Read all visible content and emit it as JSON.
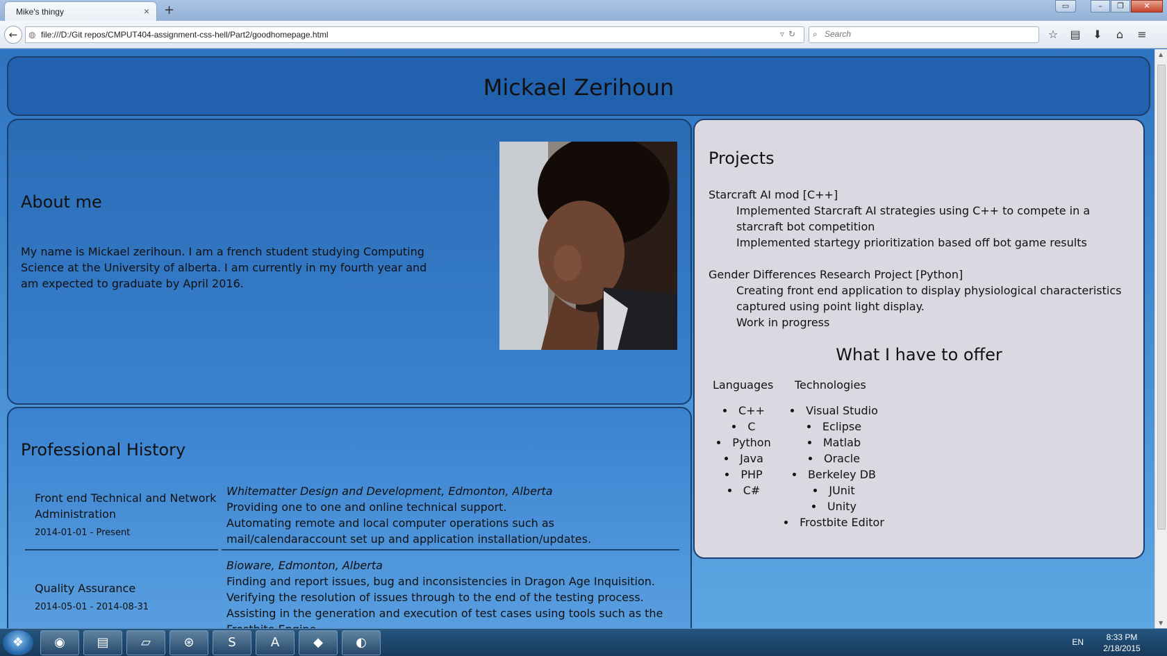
{
  "browser": {
    "tab_title": "Mike's thingy",
    "tab_close": "×",
    "new_tab": "+",
    "url": "file:///D:/Git repos/CMPUT404-assignment-css-hell/Part2/goodhomepage.html",
    "search_placeholder": "Search",
    "toolbar_icons": [
      "star-icon",
      "reading-list-icon",
      "download-icon",
      "home-icon",
      "menu-icon"
    ]
  },
  "page": {
    "name": "Mickael Zerihoun",
    "about": {
      "heading": "About me",
      "text": "My name is Mickael zerihoun. I am a french student studying Computing Science at the University of alberta. I am currently in my fourth year and am expected to graduate by April 2016."
    },
    "history": {
      "heading": "Professional History",
      "jobs": [
        {
          "role": "Front end Technical and Network Administration",
          "date": "2014-01-01 - Present",
          "company": "Whitematter Design and Development, Edmonton, Alberta",
          "lines": [
            "Providing one to one and online technical support.",
            "Automating remote and local computer operations such as mail/calendaraccount set up and application installation/updates."
          ]
        },
        {
          "role": "Quality Assurance",
          "date": "2014-05-01 - 2014-08-31",
          "company": "Bioware, Edmonton, Alberta",
          "lines": [
            "Finding and report issues, bug and inconsistencies in Dragon Age Inquisition.",
            "Verifying the resolution of issues through to the end of the testing process.",
            "Assisting in the generation and execution of test cases using tools such as the Frostbite Engine."
          ]
        }
      ]
    },
    "projects": {
      "heading": "Projects",
      "items": [
        {
          "title": "Starcraft AI mod [C++]",
          "points": [
            "Implemented Starcraft AI strategies using C++ to compete in a starcraft bot competition",
            "Implemented startegy prioritization based off bot game results"
          ]
        },
        {
          "title": "Gender Differences Research Project [Python]",
          "points": [
            "Creating front end application to display physiological characteristics captured using point light display.",
            "Work in progress"
          ]
        }
      ]
    },
    "offer": {
      "heading": "What I have to offer",
      "languages_label": "Languages",
      "languages": [
        "C++",
        "C",
        "Python",
        "Java",
        "PHP",
        "C#"
      ],
      "technologies_label": "Technologies",
      "technologies": [
        "Visual Studio",
        "Eclipse",
        "Matlab",
        "Oracle",
        "Berkeley DB",
        "JUnit",
        "Unity",
        "Frostbite Editor"
      ]
    }
  },
  "taskbar": {
    "apps": [
      "chrome-icon",
      "file-explorer-icon",
      "folder-icon",
      "steam-icon",
      "sublime-text-icon",
      "acrobat-icon",
      "git-icon",
      "firefox-icon"
    ],
    "language": "EN",
    "time": "8:33 PM",
    "date": "2/18/2015"
  },
  "colors": {
    "header_bg": "#2261ad",
    "panel_border": "#1b3f6e",
    "projects_bg": "#dcd8e2"
  }
}
